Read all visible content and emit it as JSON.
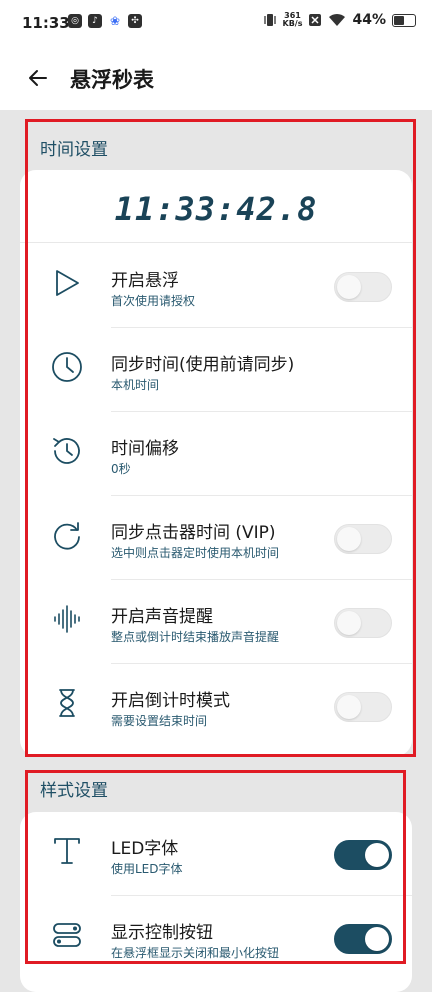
{
  "status_bar": {
    "time": "11:33",
    "net_speed_value": "361",
    "net_speed_unit": "KB/s",
    "battery": "44%",
    "battery_level": 0.44
  },
  "app_bar": {
    "title": "悬浮秒表"
  },
  "time_section": {
    "label": "时间设置",
    "clock": "11:33:42.8",
    "items": [
      {
        "title": "开启悬浮",
        "subtitle": "首次使用请授权",
        "toggle": false,
        "icon": "play-icon"
      },
      {
        "title": "同步时间(使用前请同步)",
        "subtitle": "本机时间",
        "icon": "clock-icon"
      },
      {
        "title": "时间偏移",
        "subtitle": "0秒",
        "icon": "history-icon"
      },
      {
        "title": "同步点击器时间 (VIP)",
        "subtitle": "选中则点击器定时使用本机时间",
        "toggle": false,
        "icon": "refresh-icon"
      },
      {
        "title": "开启声音提醒",
        "subtitle": "整点或倒计时结束播放声音提醒",
        "toggle": false,
        "icon": "sound-wave-icon"
      },
      {
        "title": "开启倒计时模式",
        "subtitle": "需要设置结束时间",
        "toggle": false,
        "icon": "hourglass-icon"
      }
    ]
  },
  "style_section": {
    "label": "样式设置",
    "items": [
      {
        "title": "LED字体",
        "subtitle": "使用LED字体",
        "toggle": true,
        "icon": "text-font-icon"
      },
      {
        "title": "显示控制按钮",
        "subtitle": "在悬浮框显示关闭和最小化按钮",
        "toggle": true,
        "icon": "toggle-buttons-icon"
      }
    ]
  },
  "colors": {
    "accent": "#1c4d62",
    "highlight_border": "#e01b24",
    "background": "#e6e6e6"
  }
}
